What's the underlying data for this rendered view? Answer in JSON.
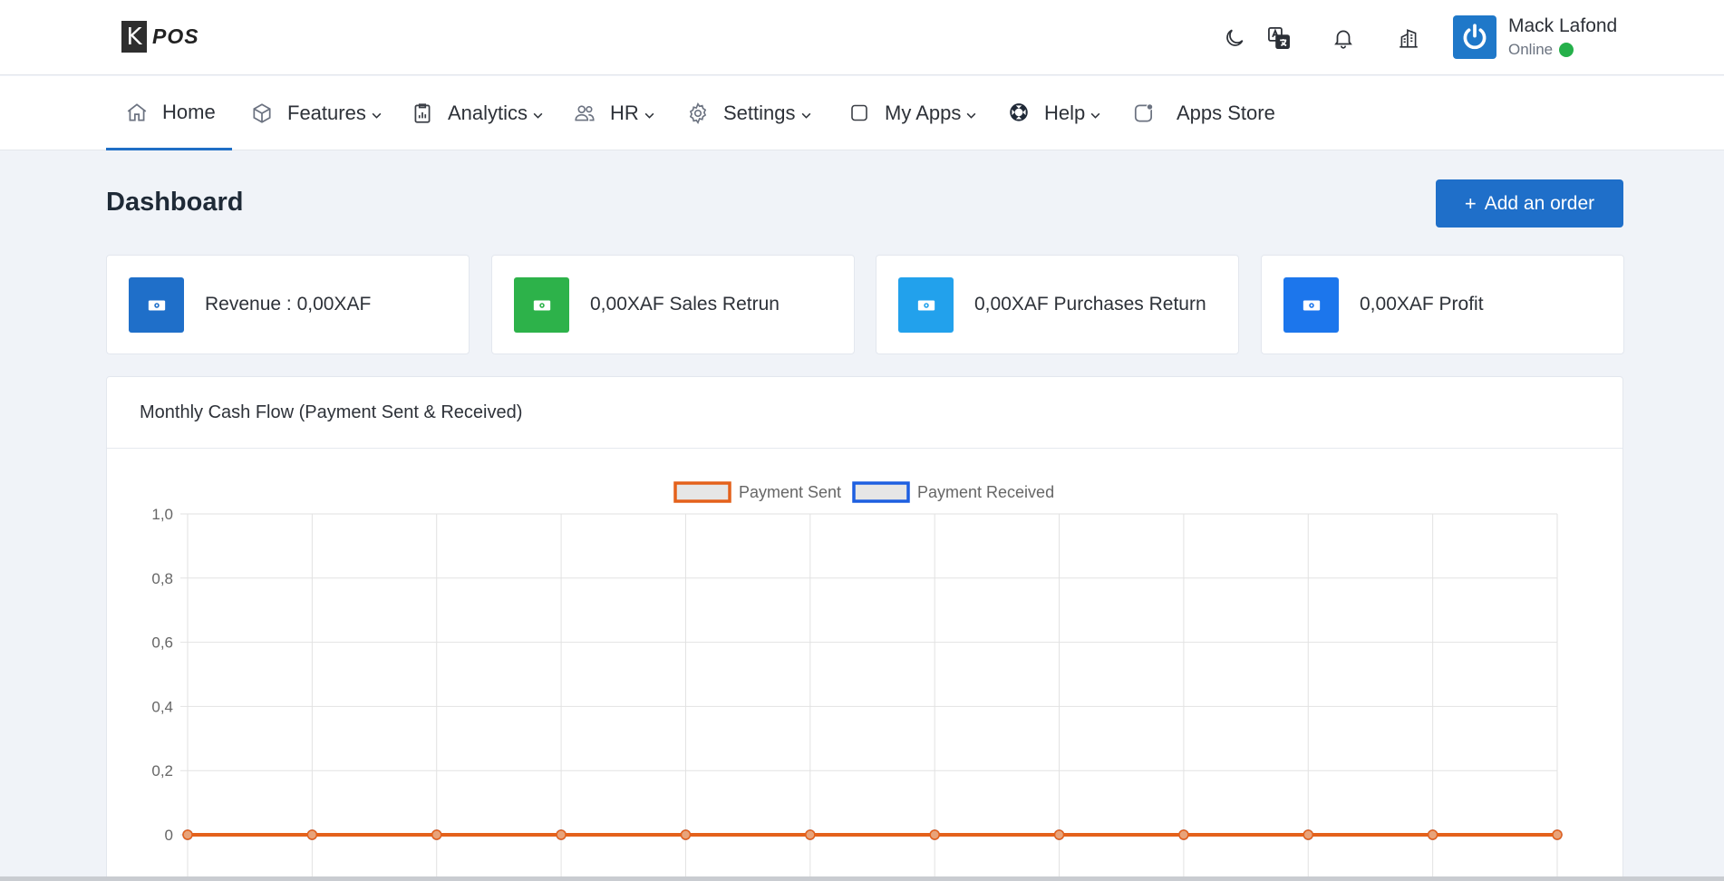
{
  "header": {
    "logo_letter": "K",
    "logo_text": "POS",
    "icons": [
      "moon-icon",
      "translate-icon",
      "bell-icon",
      "building-icon"
    ],
    "user": {
      "name": "Mack Lafond",
      "status": "Online"
    }
  },
  "nav": {
    "items": [
      {
        "label": "Home",
        "icon": "home-icon",
        "dropdown": false,
        "active": true
      },
      {
        "label": "Features",
        "icon": "box-icon",
        "dropdown": true
      },
      {
        "label": "Analytics",
        "icon": "clipboard-chart-icon",
        "dropdown": true
      },
      {
        "label": "HR",
        "icon": "users-icon",
        "dropdown": true
      },
      {
        "label": "Settings",
        "icon": "gear-icon",
        "dropdown": true
      },
      {
        "label": "My Apps",
        "icon": "square-icon",
        "dropdown": true
      },
      {
        "label": "Help",
        "icon": "lifebuoy-icon",
        "dropdown": true
      },
      {
        "label": "Apps Store",
        "icon": "app-store-icon",
        "dropdown": false
      }
    ]
  },
  "page": {
    "title": "Dashboard",
    "add_order_label": "Add an order",
    "add_order_icon": "+"
  },
  "stats": [
    {
      "label": "Revenue : 0,00XAF",
      "color": "#1f6fc9",
      "icon": "money-icon"
    },
    {
      "label": "0,00XAF Sales Retrun",
      "color": "#2db24a",
      "icon": "money-icon"
    },
    {
      "label": "0,00XAF Purchases Return",
      "color": "#22a1ec",
      "icon": "money-icon"
    },
    {
      "label": "0,00XAF Profit",
      "color": "#1c76ec",
      "icon": "money-icon"
    }
  ],
  "chart_panel": {
    "title": "Monthly Cash Flow (Payment Sent & Received)"
  },
  "chart_data": {
    "type": "line",
    "title": "",
    "x": [
      "",
      "",
      "",
      "",
      "",
      "",
      "",
      "",
      "",
      "",
      "",
      ""
    ],
    "ylim": [
      0,
      1
    ],
    "yticks": [
      "1,0",
      "0,8",
      "0,6",
      "0,4",
      "0,2",
      "0"
    ],
    "grid": true,
    "legend_position": "top",
    "series": [
      {
        "name": "Payment Sent",
        "color": "#e4611b",
        "values": [
          0,
          0,
          0,
          0,
          0,
          0,
          0,
          0,
          0,
          0,
          0,
          0
        ]
      },
      {
        "name": "Payment Received",
        "color": "#1d5fe0",
        "values": [
          0,
          0,
          0,
          0,
          0,
          0,
          0,
          0,
          0,
          0,
          0,
          0
        ]
      }
    ]
  }
}
